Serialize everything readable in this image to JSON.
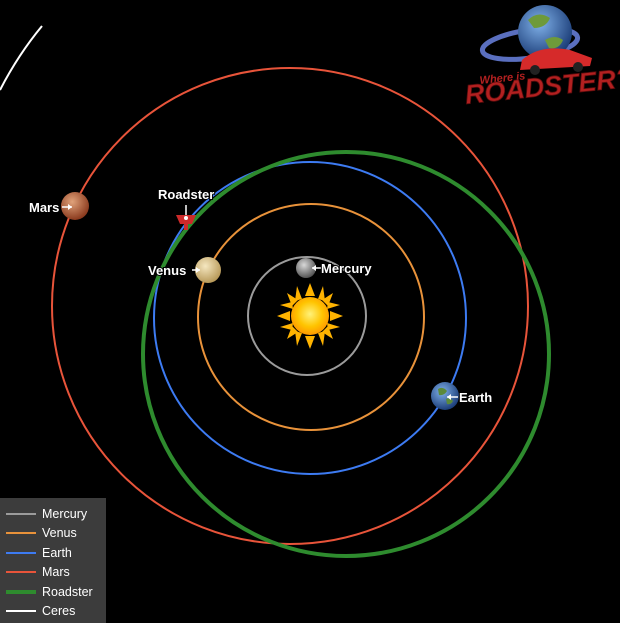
{
  "logo": {
    "tagline": "Where is",
    "title": "ROADSTER?"
  },
  "bodies": [
    {
      "id": "mercury",
      "label": "Mercury",
      "color": "#9a9a9a"
    },
    {
      "id": "venus",
      "label": "Venus",
      "color": "#d9c28a"
    },
    {
      "id": "earth",
      "label": "Earth",
      "color": "#3a6fb5"
    },
    {
      "id": "mars",
      "label": "Mars",
      "color": "#b8603c"
    },
    {
      "id": "roadster",
      "label": "Roadster",
      "color": "#cc2a2a"
    }
  ],
  "orbits": {
    "mercury": "#9b9b9b",
    "venus": "#e8923a",
    "earth": "#3d7bf2",
    "mars": "#e8543a",
    "roadster": "#2e8b2e",
    "ceres": "#ffffff"
  },
  "legend": [
    {
      "label": "Mercury",
      "color": "#9b9b9b"
    },
    {
      "label": "Venus",
      "color": "#e8923a"
    },
    {
      "label": "Earth",
      "color": "#3d7bf2"
    },
    {
      "label": "Mars",
      "color": "#e8543a"
    },
    {
      "label": "Roadster",
      "color": "#2e8b2e"
    },
    {
      "label": "Ceres",
      "color": "#ffffff"
    }
  ]
}
